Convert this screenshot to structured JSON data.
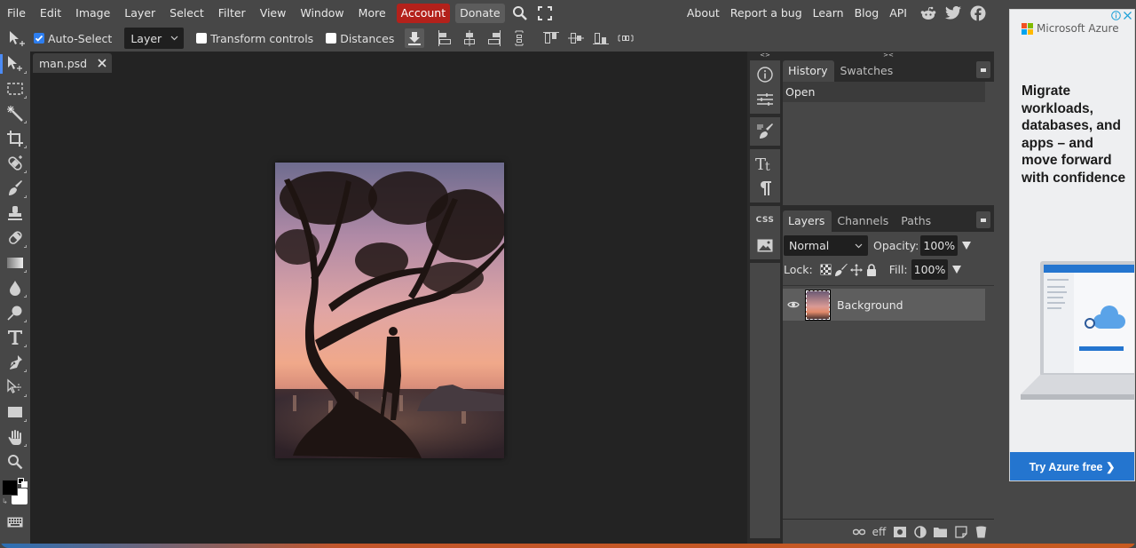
{
  "menubar": {
    "items": [
      "File",
      "Edit",
      "Image",
      "Layer",
      "Select",
      "Filter",
      "View",
      "Window",
      "More"
    ],
    "account_label": "Account",
    "donate_label": "Donate",
    "right_links": [
      "About",
      "Report a bug",
      "Learn",
      "Blog",
      "API"
    ],
    "social": [
      "reddit-icon",
      "twitter-icon",
      "facebook-icon"
    ]
  },
  "options": {
    "auto_select_label": "Auto-Select",
    "auto_select_checked": true,
    "target_select": "Layer",
    "transform_controls_label": "Transform controls",
    "transform_controls_checked": false,
    "distances_label": "Distances",
    "distances_checked": false
  },
  "tools": [
    "move",
    "marquee",
    "magic-wand",
    "crop",
    "healing",
    "brush",
    "clone-stamp",
    "eraser",
    "gradient",
    "blur",
    "dodge",
    "type",
    "pen",
    "path-select",
    "shape",
    "hand",
    "zoom"
  ],
  "colors": {
    "foreground": "#000000",
    "background": "#ffffff"
  },
  "document": {
    "tab_name": "man.psd"
  },
  "history_panel": {
    "tabs": [
      "History",
      "Swatches"
    ],
    "active_tab": "History",
    "items": [
      "Open"
    ]
  },
  "layers_panel": {
    "tabs": [
      "Layers",
      "Channels",
      "Paths"
    ],
    "active_tab": "Layers",
    "blend_mode": "Normal",
    "opacity_label": "Opacity:",
    "opacity": "100%",
    "lock_label": "Lock:",
    "fill_label": "Fill:",
    "fill": "100%",
    "layers": [
      {
        "name": "Background",
        "visible": true
      }
    ],
    "footer_effects_label": "eff"
  },
  "panel_strip": {
    "collapse_left": "<>",
    "collapse_right": "><",
    "css_label": "CSS"
  },
  "ad": {
    "brand": "Microsoft Azure",
    "headline": "Migrate workloads, databases, and apps – and move forward with confidence",
    "cta": "Try Azure free ❯",
    "accent": "#2475cf"
  }
}
